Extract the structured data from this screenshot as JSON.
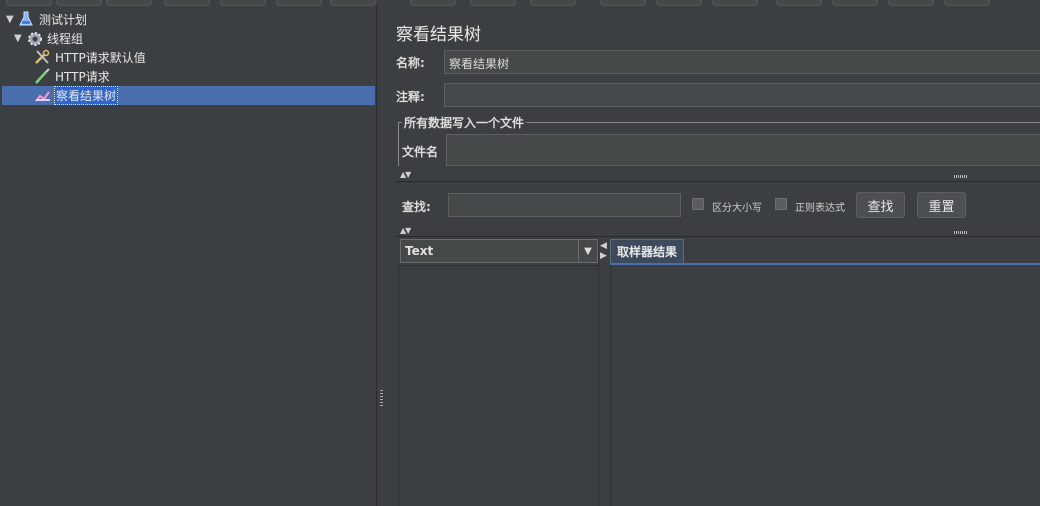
{
  "tree": {
    "items": [
      {
        "label": "测试计划",
        "icon": "beaker-icon",
        "expanded": true
      },
      {
        "label": "线程组",
        "icon": "gear-icon",
        "expanded": true
      },
      {
        "label": "HTTP请求默认值",
        "icon": "wrench-icon"
      },
      {
        "label": "HTTP请求",
        "icon": "pipette-icon"
      },
      {
        "label": "察看结果树",
        "icon": "chart-icon",
        "selected": true
      }
    ]
  },
  "panel": {
    "title": "察看结果树",
    "name_label": "名称:",
    "name_value": "察看结果树",
    "comment_label": "注释:",
    "comment_value": "",
    "file_group_label": "所有数据写入一个文件",
    "filename_label": "文件名",
    "filename_value": ""
  },
  "search": {
    "label": "查找:",
    "value": "",
    "case_label": "区分大小写",
    "regex_label": "正则表达式",
    "find_button": "查找",
    "reset_button": "重置"
  },
  "results": {
    "renderer_selected": "Text",
    "tab_label": "取样器结果"
  },
  "colors": {
    "background": "#3c3f41",
    "selection": "#4b6eaf",
    "field": "#45494a"
  }
}
